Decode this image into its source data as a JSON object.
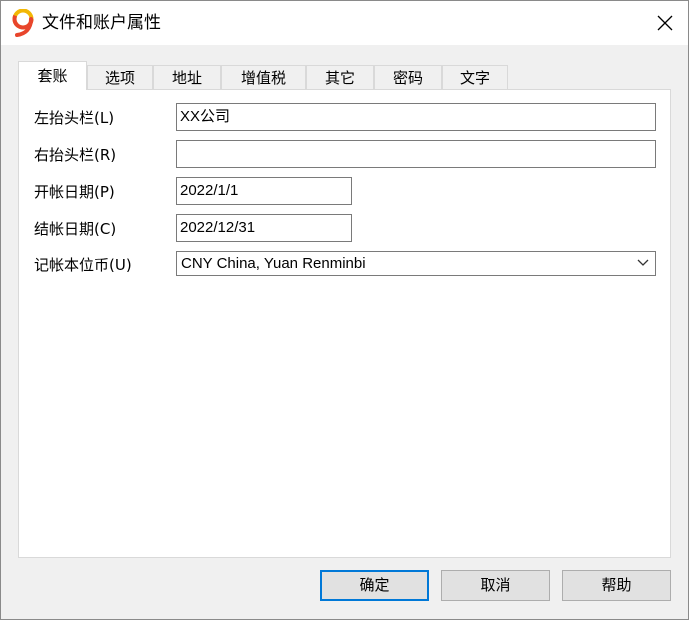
{
  "window": {
    "title": "文件和账户属性",
    "icon": "nine-logo-icon",
    "close_label": "close-icon"
  },
  "tabs": [
    {
      "label": "套账",
      "active": true
    },
    {
      "label": "选项",
      "active": false
    },
    {
      "label": "地址",
      "active": false
    },
    {
      "label": "增值税",
      "active": false
    },
    {
      "label": "其它",
      "active": false
    },
    {
      "label": "密码",
      "active": false
    },
    {
      "label": "文字",
      "active": false
    }
  ],
  "form": {
    "left_header": {
      "label": "左抬头栏(L)",
      "value": "XX公司"
    },
    "right_header": {
      "label": "右抬头栏(R)",
      "value": ""
    },
    "opening_date": {
      "label": "开帐日期(P)",
      "value": "2022/1/1"
    },
    "closing_date": {
      "label": "结帐日期(C)",
      "value": "2022/12/31"
    },
    "base_currency": {
      "label": "记帐本位币(U)",
      "value": "CNY China, Yuan Renminbi"
    }
  },
  "buttons": {
    "ok": "确定",
    "cancel": "取消",
    "help": "帮助"
  },
  "colors": {
    "accent": "#0078d7",
    "logo_red": "#e8452c",
    "logo_yellow": "#f2b705"
  }
}
